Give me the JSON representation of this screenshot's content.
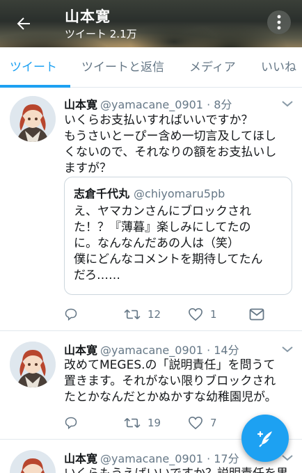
{
  "header": {
    "title": "山本寛",
    "subtitle": "ツイート 2.1万"
  },
  "tabs": [
    {
      "label": "ツイート",
      "active": true
    },
    {
      "label": "ツイートと返信",
      "active": false
    },
    {
      "label": "メディア",
      "active": false
    },
    {
      "label": "いいね",
      "active": false
    }
  ],
  "tweets": [
    {
      "name": "山本寛",
      "handle": "@yamacane_0901 · 8分",
      "lines": [
        "いくらお支払いすればいいですか？",
        "もうさいとーぴー含め一切言及してほし",
        "くないので、それなりの額をお支払いし",
        "ますが？"
      ],
      "quote": {
        "name": "志倉千代丸",
        "handle": "@chiyomaru5pb",
        "lines": [
          "え、ヤマカンさんにブロックされ",
          "た！？『薄暮』楽しみにしてたの",
          "に。なんなんだあの人は（笑）",
          "僕にどんなコメントを期待してたん",
          "だろ……"
        ]
      },
      "retweets": "12",
      "likes": "1"
    },
    {
      "name": "山本寛",
      "handle": "@yamacane_0901 · 14分",
      "lines": [
        "改めてMEGES.の「説明責任」を問うて",
        "置きます。それがない限りブロックされ",
        "たとかなんだとかぬかすな幼稚園児が。"
      ],
      "retweets": "19",
      "likes": "7"
    },
    {
      "name": "山本寛",
      "handle": "@yamacane_0901 · 17分",
      "lines": [
        "いくらもうえばいいですか？説明責任を果"
      ]
    }
  ],
  "colors": {
    "accent": "#1da1f2",
    "muted": "#657786",
    "border": "#e1e8ed"
  },
  "icons": {
    "back": "arrow-left-icon",
    "more": "more-vertical-icon",
    "reply": "reply-icon",
    "retweet": "retweet-icon",
    "like": "heart-icon",
    "dm": "envelope-icon",
    "compose": "compose-icon"
  }
}
